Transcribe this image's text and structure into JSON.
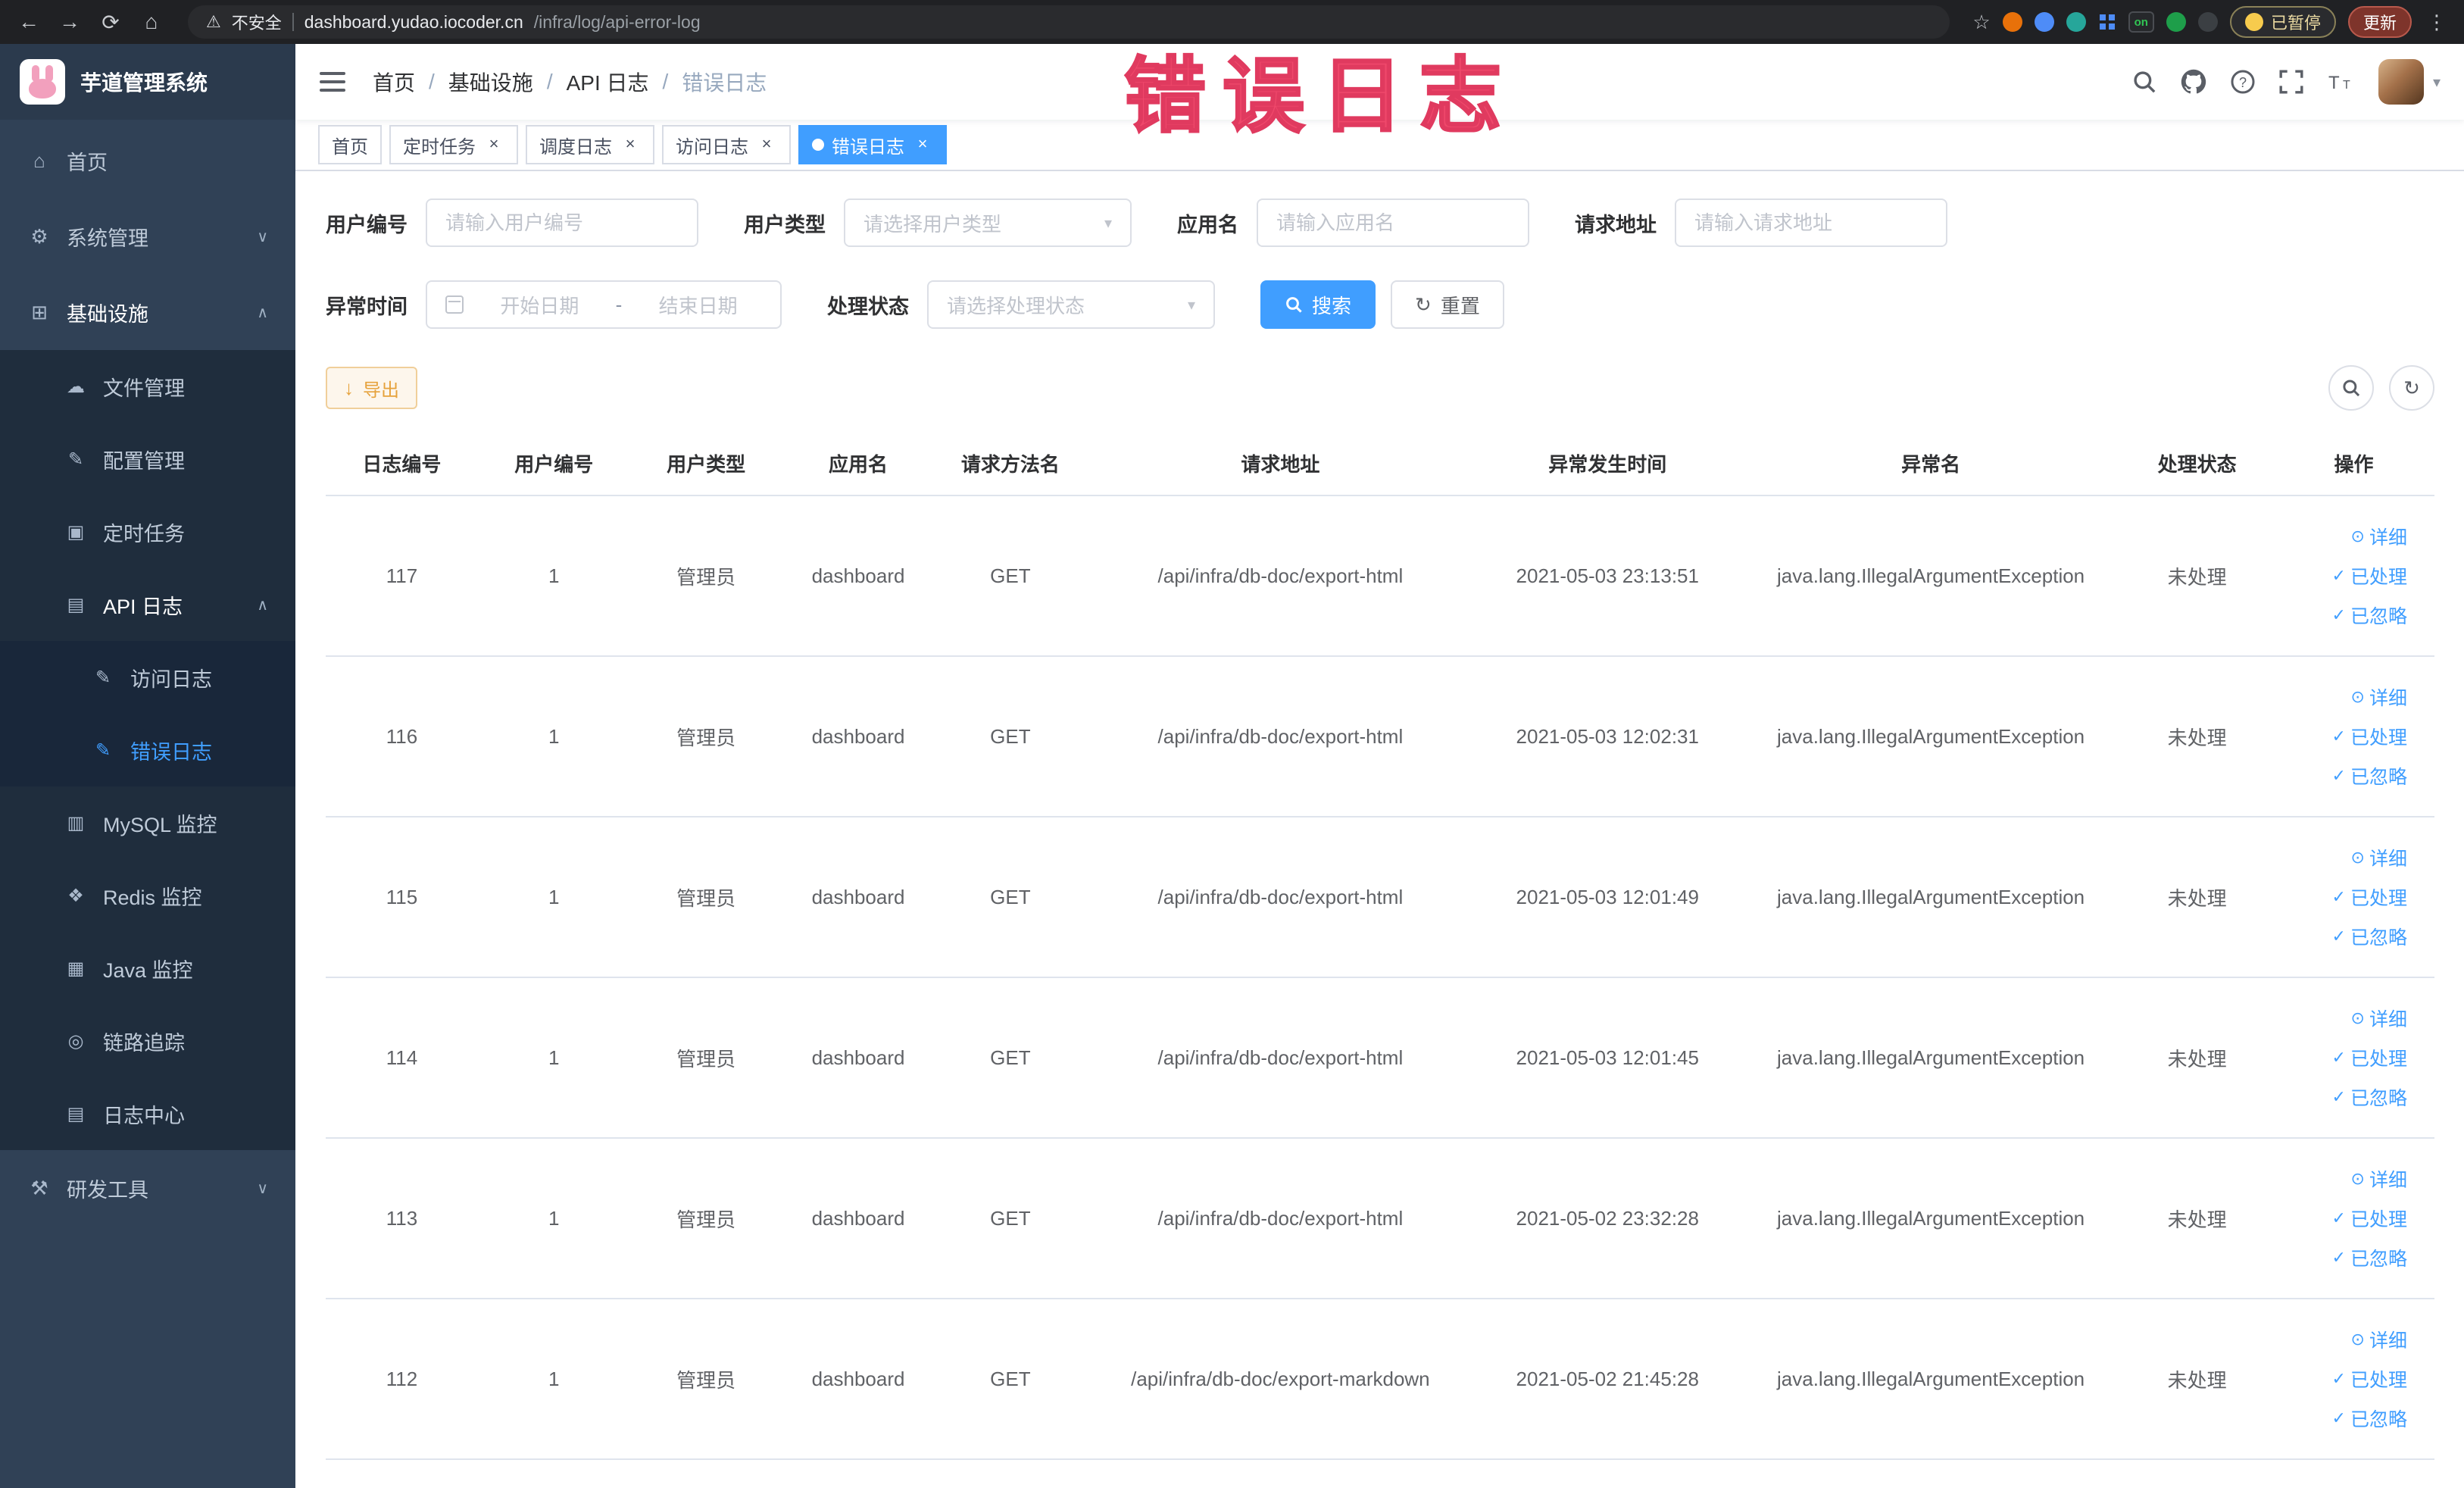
{
  "browser": {
    "security_label": "不安全",
    "url_domain": "dashboard.yudao.iocoder.cn",
    "url_path": "/infra/log/api-error-log",
    "extension_on_badge": "on",
    "paused_chip": "已暂停",
    "update_chip": "更新"
  },
  "annotation": {
    "text": "错误日志"
  },
  "icons": {
    "back": "←",
    "forward": "→",
    "reload": "⟳",
    "home": "⌂",
    "warning": "⚠",
    "star": "☆",
    "more_vertical": "⋮",
    "menu_home": "⌂",
    "menu_system": "⚙",
    "menu_infra": "⊞",
    "menu_file": "☁",
    "menu_config": "✎",
    "menu_task": "▣",
    "menu_api_log": "▤",
    "menu_access_log": "✎",
    "menu_error_log": "✎",
    "menu_mysql": "▥",
    "menu_redis": "❖",
    "menu_java": "▦",
    "menu_trace": "◎",
    "menu_log_center": "▤",
    "menu_tools": "⚒",
    "chevron_down": "∨",
    "chevron_up": "∧",
    "caret_down": "▾",
    "close": "×",
    "refresh": "↻",
    "columns": "⊞",
    "download": "↓",
    "view": "⊙",
    "check": "✓",
    "question_mark": "?",
    "font_big": "T",
    "font_small": "T"
  },
  "sidebar": {
    "logo_title": "芋道管理系统",
    "items": [
      {
        "label": "首页"
      },
      {
        "label": "系统管理"
      },
      {
        "label": "基础设施"
      },
      {
        "label": "文件管理"
      },
      {
        "label": "配置管理"
      },
      {
        "label": "定时任务"
      },
      {
        "label": "API 日志"
      },
      {
        "label": "访问日志"
      },
      {
        "label": "错误日志"
      },
      {
        "label": "MySQL 监控"
      },
      {
        "label": "Redis 监控"
      },
      {
        "label": "Java 监控"
      },
      {
        "label": "链路追踪"
      },
      {
        "label": "日志中心"
      },
      {
        "label": "研发工具"
      }
    ]
  },
  "navbar": {
    "separator": "/",
    "breadcrumb": [
      {
        "label": "首页"
      },
      {
        "label": "基础设施"
      },
      {
        "label": "API 日志"
      },
      {
        "label": "错误日志"
      }
    ]
  },
  "tabs": [
    {
      "label": "首页"
    },
    {
      "label": "定时任务"
    },
    {
      "label": "调度日志"
    },
    {
      "label": "访问日志"
    },
    {
      "label": "错误日志"
    }
  ],
  "filters": {
    "user_id_label": "用户编号",
    "user_id_placeholder": "请输入用户编号",
    "user_type_label": "用户类型",
    "user_type_placeholder": "请选择用户类型",
    "app_name_label": "应用名",
    "app_name_placeholder": "请输入应用名",
    "request_url_label": "请求地址",
    "request_url_placeholder": "请输入请求地址",
    "time_label": "异常时间",
    "time_start_placeholder": "开始日期",
    "time_separator": "-",
    "time_end_placeholder": "结束日期",
    "status_label": "处理状态",
    "status_placeholder": "请选择处理状态",
    "search_button": "搜索",
    "reset_button": "重置"
  },
  "toolbar": {
    "export_button": "导出"
  },
  "table": {
    "headers": [
      "日志编号",
      "用户编号",
      "用户类型",
      "应用名",
      "请求方法名",
      "请求地址",
      "异常发生时间",
      "异常名",
      "处理状态",
      "操作"
    ],
    "action_labels": [
      "详细",
      "已处理",
      "已忽略"
    ],
    "rows": [
      {
        "log_id": "117",
        "user_id": "1",
        "user_type": "管理员",
        "app_name": "dashboard",
        "method": "GET",
        "url": "/api/infra/db-doc/export-html",
        "time": "2021-05-03 23:13:51",
        "exception": "java.lang.IllegalArgumentException",
        "status": "未处理"
      },
      {
        "log_id": "116",
        "user_id": "1",
        "user_type": "管理员",
        "app_name": "dashboard",
        "method": "GET",
        "url": "/api/infra/db-doc/export-html",
        "time": "2021-05-03 12:02:31",
        "exception": "java.lang.IllegalArgumentException",
        "status": "未处理"
      },
      {
        "log_id": "115",
        "user_id": "1",
        "user_type": "管理员",
        "app_name": "dashboard",
        "method": "GET",
        "url": "/api/infra/db-doc/export-html",
        "time": "2021-05-03 12:01:49",
        "exception": "java.lang.IllegalArgumentException",
        "status": "未处理"
      },
      {
        "log_id": "114",
        "user_id": "1",
        "user_type": "管理员",
        "app_name": "dashboard",
        "method": "GET",
        "url": "/api/infra/db-doc/export-html",
        "time": "2021-05-03 12:01:45",
        "exception": "java.lang.IllegalArgumentException",
        "status": "未处理"
      },
      {
        "log_id": "113",
        "user_id": "1",
        "user_type": "管理员",
        "app_name": "dashboard",
        "method": "GET",
        "url": "/api/infra/db-doc/export-html",
        "time": "2021-05-02 23:32:28",
        "exception": "java.lang.IllegalArgumentException",
        "status": "未处理"
      },
      {
        "log_id": "112",
        "user_id": "1",
        "user_type": "管理员",
        "app_name": "dashboard",
        "method": "GET",
        "url": "/api/infra/db-doc/export-markdown",
        "time": "2021-05-02 21:45:28",
        "exception": "java.lang.IllegalArgumentException",
        "status": "未处理"
      }
    ]
  },
  "colors": {
    "primary": "#409EFF",
    "warning": "#e6a23c",
    "sidebar_bg": "#304156",
    "submenu_bg": "#1f2d3d",
    "annotation_red": "#ef486b"
  }
}
